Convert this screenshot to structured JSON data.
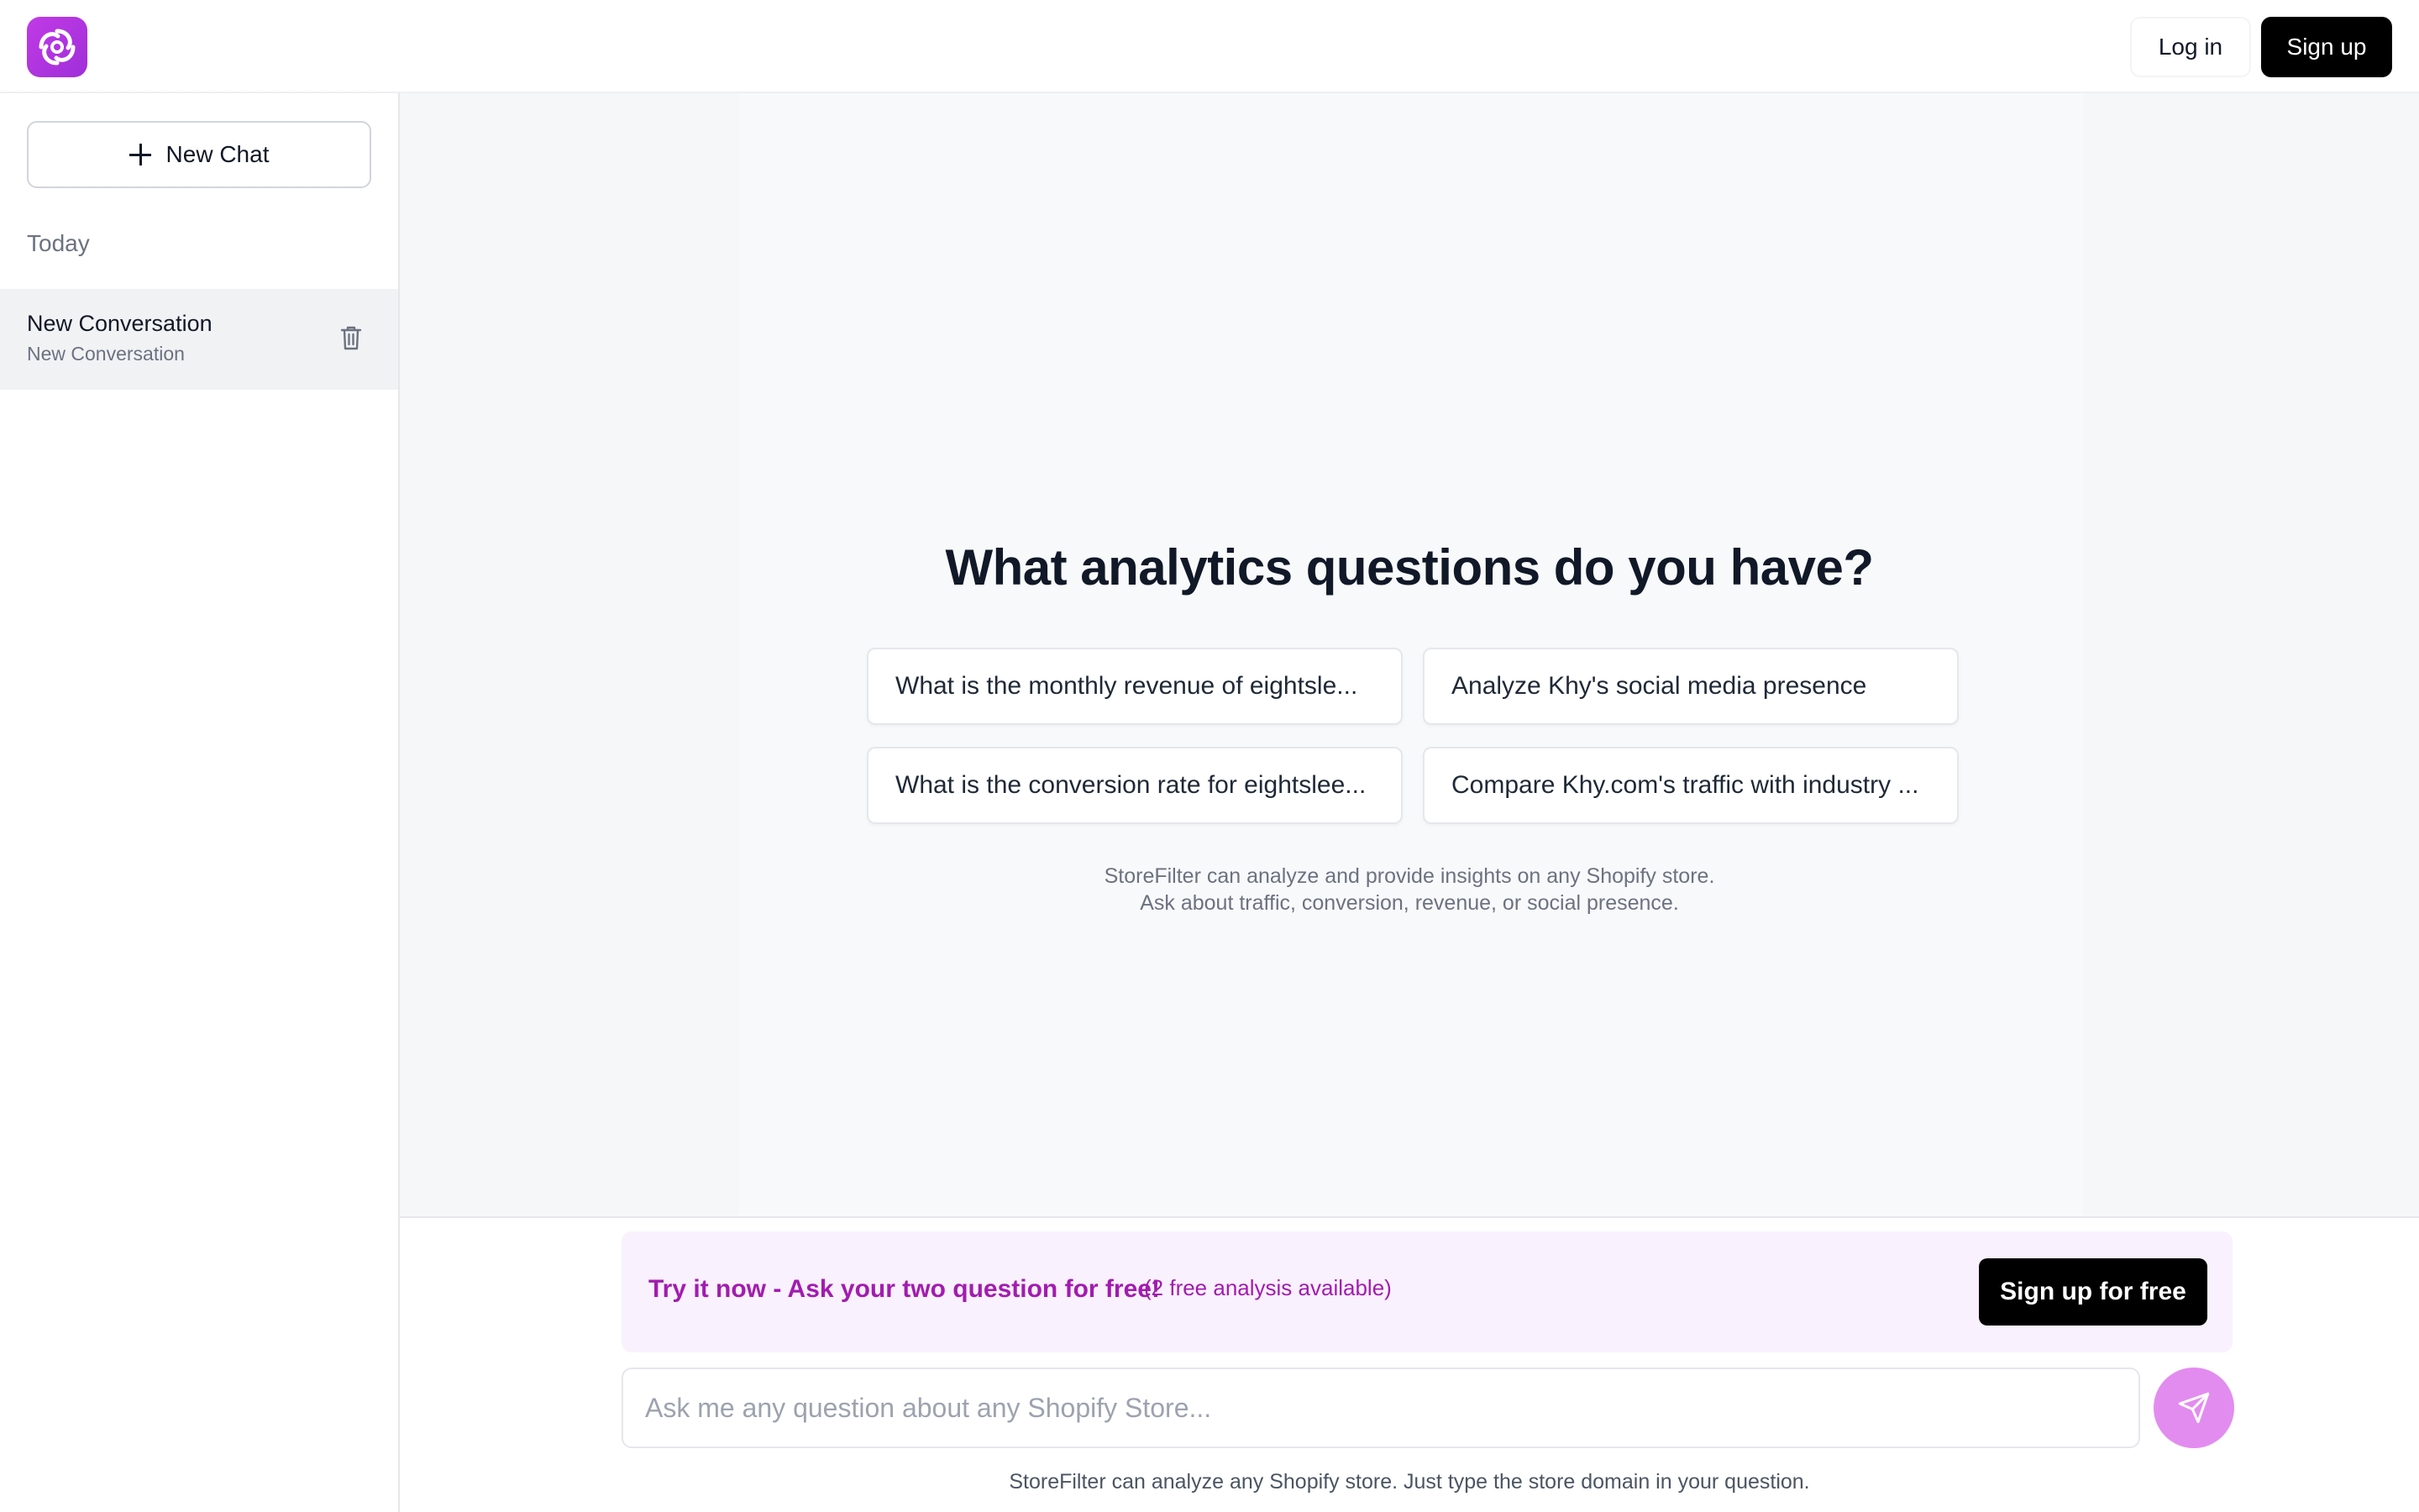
{
  "header": {
    "logo_icon": "swirl-logo-icon",
    "login_label": "Log in",
    "signup_label": "Sign up"
  },
  "sidebar": {
    "new_chat_label": "New Chat",
    "section_label": "Today",
    "conversations": [
      {
        "title": "New Conversation",
        "subtitle": "New Conversation"
      }
    ]
  },
  "main": {
    "title": "What analytics questions do you have?",
    "suggestions": [
      "What is the monthly revenue of eightsle...",
      "Analyze Khy's social media presence",
      "What is the conversion rate for eightslee...",
      "Compare Khy.com's traffic with industry ..."
    ],
    "help_line1": "StoreFilter can analyze and provide insights on any Shopify store.",
    "help_line2": "Ask about traffic, conversion, revenue, or social presence."
  },
  "promo": {
    "main_text": "Try it now - Ask your two question for free!",
    "sub_text": "(2 free analysis available)",
    "button_label": "Sign up for free"
  },
  "composer": {
    "placeholder": "Ask me any question about any Shopify Store...",
    "footer_text": "StoreFilter can analyze any Shopify store. Just type the store domain in your question."
  },
  "colors": {
    "brand": "#b535e0",
    "promo_text": "#a21caf",
    "send_button": "#e38cf0"
  }
}
